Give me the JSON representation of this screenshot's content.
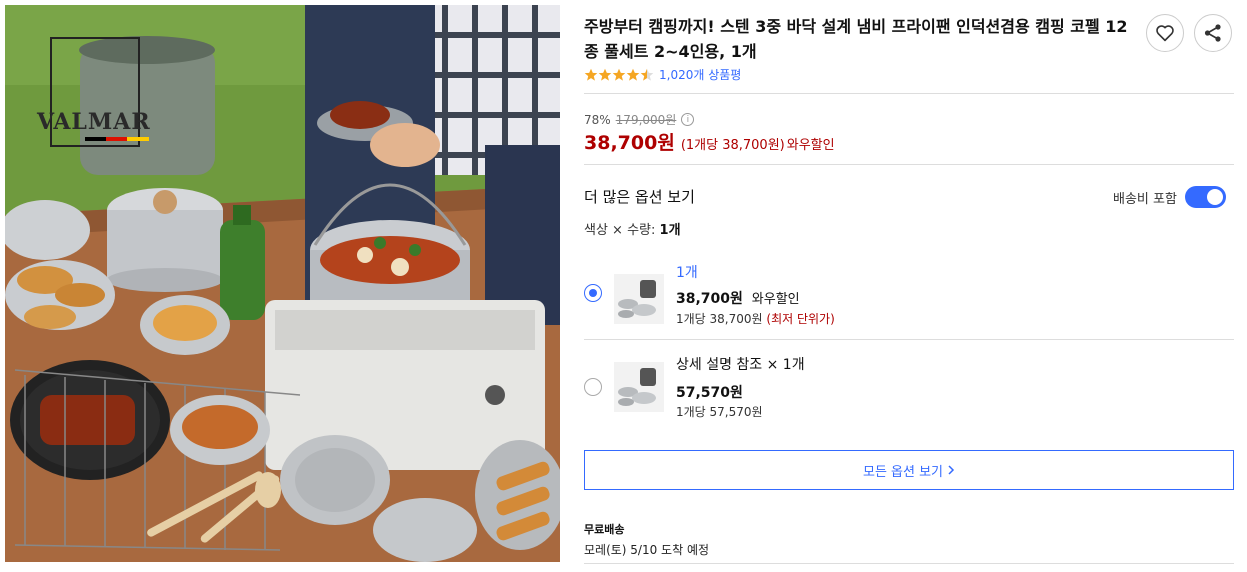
{
  "product": {
    "title": "주방부터 캠핑까지! 스텐 3중 바닥 설계 냄비 프라이팬 인덕션겸용 캠핑 코펠 12종 풀세트 2~4인용, 1개",
    "image_alt": "스텐 캠핑 코펠 세트"
  },
  "brand_logo_text": "VALMAR",
  "actions": {
    "wish_icon": "heart-icon",
    "share_icon": "share-icon"
  },
  "rating": {
    "stars": 4.5,
    "review_count": "1,020개 상품평"
  },
  "price": {
    "discount": "78%",
    "original": "179,000원",
    "sale": "38,700원",
    "unit_info": "(1개당 38,700원)",
    "tag": "와우할인"
  },
  "options": {
    "heading": "더 많은 옵션 보기",
    "shipping_toggle_label": "배송비 포함",
    "shipping_toggle_on": true,
    "summary_prefix": "색상 × 수량:",
    "summary_value": "1개",
    "items": [
      {
        "name": "1개",
        "price": "38,700원",
        "tag": "와우할인",
        "unit": "1개당 38,700원",
        "unit_note": "(최저 단위가)",
        "selected": true
      },
      {
        "name": "상세 설명 참조 × 1개",
        "price": "57,570원",
        "tag": "",
        "unit": "1개당 57,570원",
        "unit_note": "",
        "selected": false
      }
    ],
    "all_button": "모든 옵션 보기"
  },
  "shipping": {
    "label": "무료배송",
    "arrival": "모레(토) 5/10 도착 예정"
  },
  "colors": {
    "accent": "#346aff",
    "price_red": "#ae0000",
    "star": "#f5a623"
  }
}
